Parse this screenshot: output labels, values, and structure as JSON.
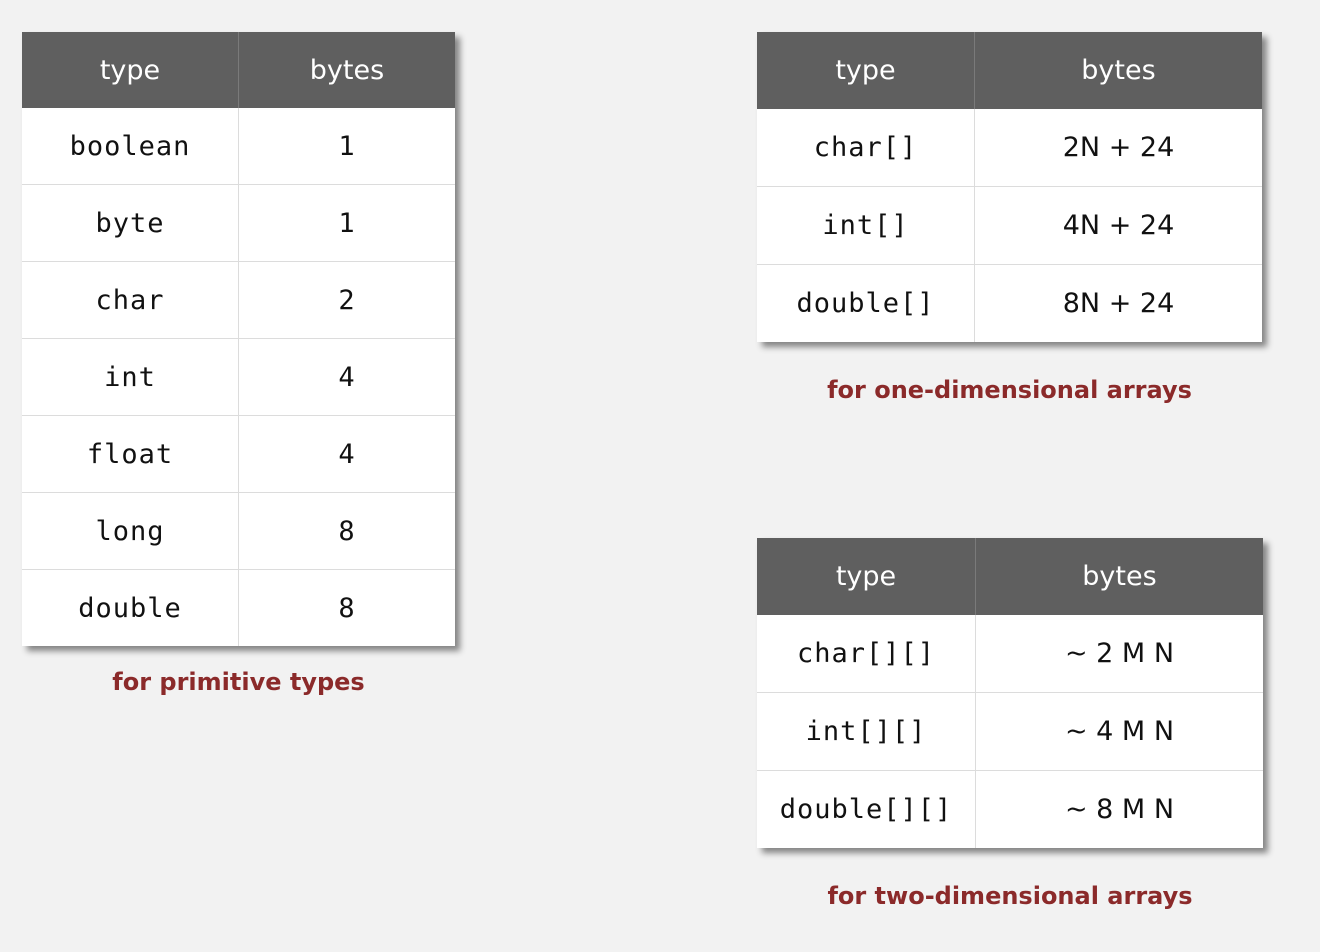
{
  "primitive": {
    "headers": {
      "type": "type",
      "bytes": "bytes"
    },
    "rows": [
      {
        "type": "boolean",
        "bytes": "1"
      },
      {
        "type": "byte",
        "bytes": "1"
      },
      {
        "type": "char",
        "bytes": "2"
      },
      {
        "type": "int",
        "bytes": "4"
      },
      {
        "type": "float",
        "bytes": "4"
      },
      {
        "type": "long",
        "bytes": "8"
      },
      {
        "type": "double",
        "bytes": "8"
      }
    ],
    "caption": "for primitive types"
  },
  "one_dim": {
    "headers": {
      "type": "type",
      "bytes": "bytes"
    },
    "rows": [
      {
        "type": "char[]",
        "bytes": "2N + 24"
      },
      {
        "type": "int[]",
        "bytes": "4N + 24"
      },
      {
        "type": "double[]",
        "bytes": "8N + 24"
      }
    ],
    "caption": "for one-dimensional arrays"
  },
  "two_dim": {
    "headers": {
      "type": "type",
      "bytes": "bytes"
    },
    "rows": [
      {
        "type": "char[][]",
        "bytes": "~ 2 M N"
      },
      {
        "type": "int[][]",
        "bytes": "~ 4 M N"
      },
      {
        "type": "double[][]",
        "bytes": "~ 8 M N"
      }
    ],
    "caption": "for two-dimensional arrays"
  },
  "colors": {
    "header_bg": "#5f5f5f",
    "caption": "#8b2a2a",
    "highlight": "#8b2a2a",
    "background": "#f2f2f2"
  }
}
